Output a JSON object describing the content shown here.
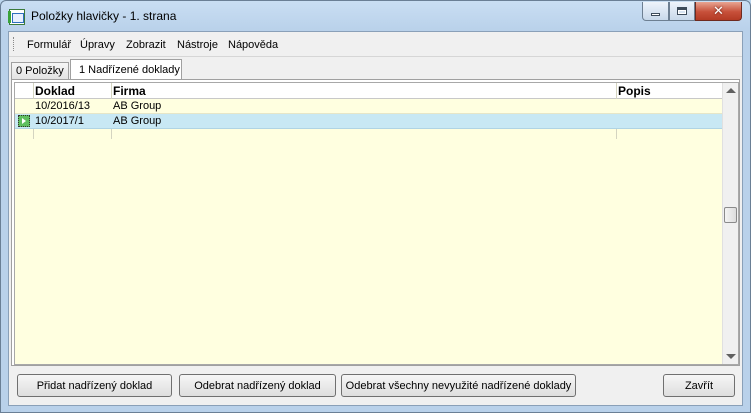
{
  "window": {
    "title": "Položky hlavičky - 1. strana"
  },
  "menu": {
    "items": [
      "Formulář",
      "Úpravy",
      "Zobrazit",
      "Nástroje",
      "Nápověda"
    ]
  },
  "tabs": [
    {
      "label": "0 Položky",
      "active": false
    },
    {
      "label": "1 Nadřízené doklady",
      "active": true
    }
  ],
  "grid": {
    "columns": [
      "Doklad",
      "Firma",
      "Popis"
    ],
    "rows": [
      {
        "doklad": "10/2016/13",
        "firma": "AB Group",
        "popis": "",
        "selected": false
      },
      {
        "doklad": "10/2017/1",
        "firma": "AB Group",
        "popis": "",
        "selected": true
      }
    ]
  },
  "buttons": {
    "add": "Přidat nadřízený doklad",
    "remove": "Odebrat nadřízený doklad",
    "remove_all": "Odebrat všechny nevyužité nadřízené doklady",
    "close": "Zavřít"
  },
  "colors": {
    "grid_background": "#ffffe0",
    "selected_row": "#c8e8f4",
    "title_gradient": "#b9d1ea",
    "close_button": "#c7503a"
  }
}
